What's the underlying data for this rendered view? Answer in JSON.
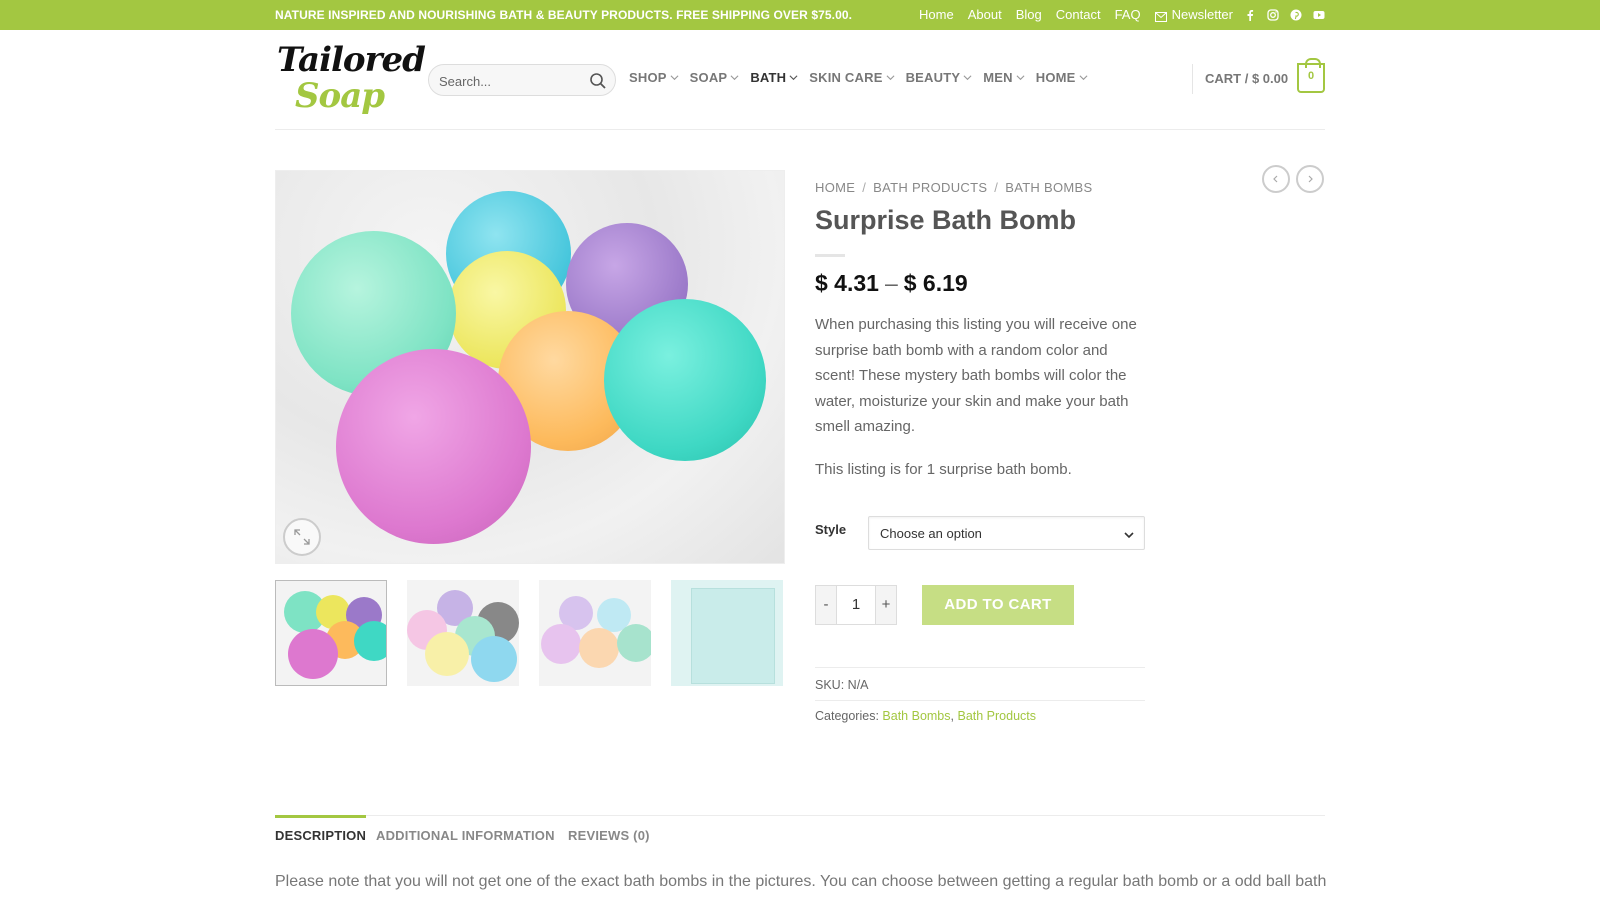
{
  "topbar": {
    "promo": "NATURE INSPIRED AND NOURISHING BATH & BEAUTY PRODUCTS. FREE SHIPPING OVER $75.00.",
    "links": [
      "Home",
      "About",
      "Blog",
      "Contact",
      "FAQ"
    ],
    "newsletter": "Newsletter",
    "social_icons": [
      "facebook-icon",
      "instagram-icon",
      "pinterest-icon",
      "youtube-icon"
    ],
    "bg_color": "#a3c741"
  },
  "header": {
    "logo_line1": "Tailored",
    "logo_line2": "Soap",
    "search_placeholder": "Search...",
    "nav": [
      "SHOP",
      "SOAP",
      "BATH",
      "SKIN CARE",
      "BEAUTY",
      "MEN",
      "HOME"
    ],
    "nav_active": "BATH",
    "cart_label": "CART /",
    "cart_total": "$ 0.00",
    "cart_count": "0"
  },
  "breadcrumb": [
    "HOME",
    "BATH PRODUCTS",
    "BATH BOMBS"
  ],
  "product": {
    "title": "Surprise Bath Bomb",
    "price_min": "$ 4.31",
    "price_dash": "–",
    "price_max": "$ 6.19",
    "description": "When purchasing this listing you will receive one surprise bath bomb with a random color and scent! These mystery bath bombs will color the water, moisturize your skin and make your bath smell amazing.",
    "note": "This listing is for 1 surprise bath bomb.",
    "style_label": "Style",
    "style_selected": "Choose an option",
    "qty_minus": "-",
    "qty_value": "1",
    "qty_plus": "+",
    "add_to_cart": "ADD TO CART",
    "sku_label": "SKU:",
    "sku_value": "N/A",
    "categories_label": "Categories:",
    "category_1": "Bath Bombs",
    "category_sep": ",",
    "category_2": "Bath Products",
    "accent_color": "#a3c741"
  },
  "tabs": {
    "items": [
      "DESCRIPTION",
      "ADDITIONAL INFORMATION",
      "REVIEWS (0)"
    ],
    "active": "DESCRIPTION",
    "description_text": "Please note that you will not get one of the exact bath bombs in the pictures. You can choose between getting a regular bath bomb or a odd ball bath"
  }
}
